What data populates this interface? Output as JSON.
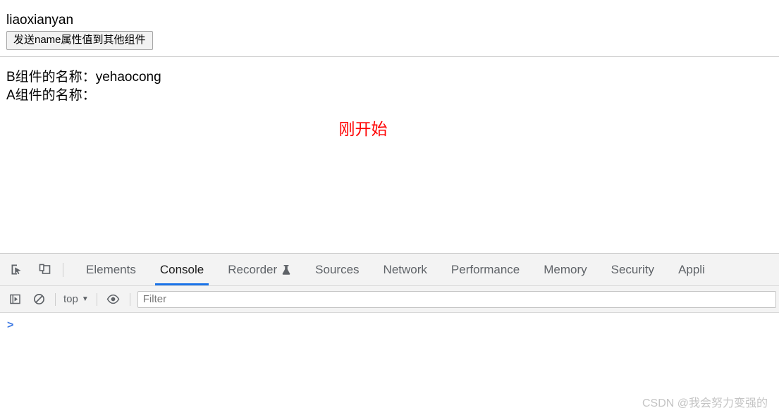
{
  "page": {
    "title": "liaoxianyan",
    "send_button_label": "发送name属性值到其他组件",
    "component_b_label": "B组件的名称：",
    "component_b_value": "yehaocong",
    "component_a_label": "A组件的名称：",
    "component_a_value": "",
    "status_text": "刚开始",
    "status_color": "#ff0000"
  },
  "devtools": {
    "icons": {
      "inspect": "inspect-element-icon",
      "device": "device-toolbar-icon",
      "execute": "execute-snippet-icon",
      "clear": "clear-console-icon",
      "eye": "console-settings-eye-icon"
    },
    "tabs": [
      {
        "label": "Elements",
        "active": false
      },
      {
        "label": "Console",
        "active": true
      },
      {
        "label": "Recorder",
        "active": false,
        "badge": "flask-icon"
      },
      {
        "label": "Sources",
        "active": false
      },
      {
        "label": "Network",
        "active": false
      },
      {
        "label": "Performance",
        "active": false
      },
      {
        "label": "Memory",
        "active": false
      },
      {
        "label": "Security",
        "active": false
      },
      {
        "label": "Appli",
        "active": false
      }
    ],
    "filterbar": {
      "context": "top",
      "caret": "▼",
      "filter_placeholder": "Filter",
      "filter_value": ""
    },
    "console": {
      "prompt": ">",
      "input_value": ""
    },
    "accent_color": "#1a73e8"
  },
  "watermark": "CSDN @我会努力变强的"
}
